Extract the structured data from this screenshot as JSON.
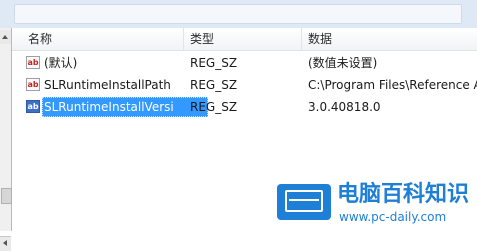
{
  "list": {
    "columns": {
      "name": "名称",
      "type": "类型",
      "data": "数据"
    },
    "rows": [
      {
        "icon": "ab",
        "name": "(默认)",
        "type": "REG_SZ",
        "data": "(数值未设置)"
      },
      {
        "icon": "ab",
        "name": "SLRuntimeInstallPath",
        "type": "REG_SZ",
        "data": "C:\\Program Files\\Reference A"
      },
      {
        "icon": "ab",
        "name": "SLRuntimeInstallVersi",
        "type": "REG_SZ",
        "data": "3.0.40818.0",
        "selected": true
      }
    ]
  },
  "watermark": {
    "title": "电脑百科知识",
    "url": "www.pc-daily.com",
    "color": "#1e7fd6"
  },
  "colors": {
    "selection": "#3399ff",
    "header_background": "#f1f3f6",
    "window_frame": "#dfe9f5"
  },
  "icons": {
    "row_icon": "string-value-icon",
    "watermark_logo": "monitor-icon"
  }
}
